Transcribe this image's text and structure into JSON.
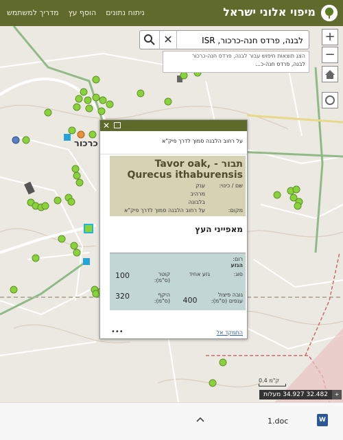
{
  "header": {
    "title": "מיפוי אלוני ישראל",
    "nav": [
      "מדריך למשתמש",
      "הוסף עץ",
      "ניתוח נתונים"
    ]
  },
  "search": {
    "value": "לבנה, פרדס חנה-כרכור, ISR",
    "suggest_hint": "הצג תוצאות חיפוש עבור לבנה, פרדס חנה-כרכור",
    "suggest_item": "לבנה, פרדס חנה-כ..."
  },
  "map": {
    "place_label": "כרכור",
    "scale_label": "0.4 ק\"מ",
    "coords": "32.482 34.927 מעלות",
    "coords_btn": "+"
  },
  "popup": {
    "location_title": "על רחוב הלבנה סמוך לדרך פיק\"א",
    "tree_title": "תבור - Tavor oak, Qurecus ithaburensis",
    "name_label": "שם / כינוי:",
    "name_values": [
      "ענק",
      "מרהיב",
      "בלבונה"
    ],
    "place_label": "מקום:",
    "place_value": "על רחוב הלבנה סמוך לדרך פיק\"א",
    "features_title": "מאפייני העץ",
    "height_label": "רום:",
    "trunk_label": "הגזע",
    "type_label": "סוג:",
    "type_value": "גזע אחיד",
    "diameter_label": "קוטר (ס\"מ):",
    "diameter_value": "100",
    "branch_height_label": "גובה פיצול ענפים (ס\"מ):",
    "branch_height_value": "400",
    "circumference_label": "היקף (ס\"מ):",
    "circumference_value": "320",
    "more": "•••",
    "zoom_link": "התמקד אל"
  },
  "download": {
    "file_name": "1.doc",
    "file_icon": "W"
  },
  "colors": {
    "header": "#606a2c",
    "tree_point": "#8ad23a",
    "popup_tan": "#d6d2b4",
    "popup_blue": "#c2d6d6"
  }
}
